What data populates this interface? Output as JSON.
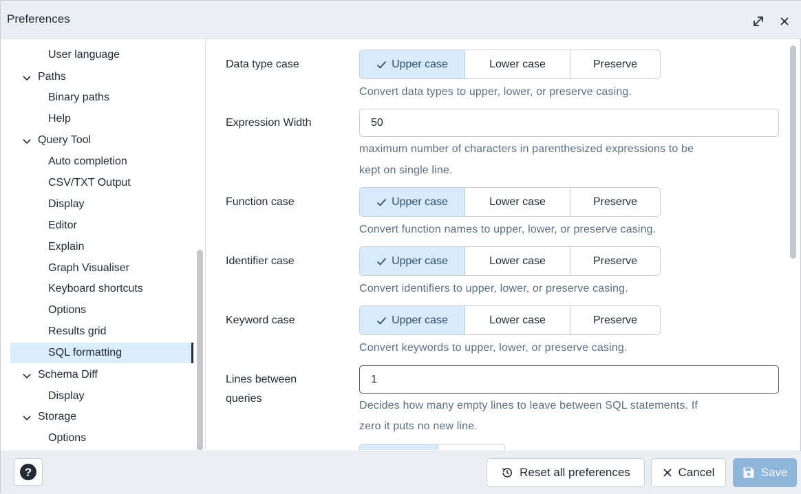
{
  "window": {
    "title": "Preferences",
    "icons": {
      "expand": "expand-icon",
      "close": "close-icon"
    }
  },
  "nav": {
    "items": [
      {
        "label": "User language",
        "type": "child"
      },
      {
        "label": "Paths",
        "type": "parent"
      },
      {
        "label": "Binary paths",
        "type": "child"
      },
      {
        "label": "Help",
        "type": "child"
      },
      {
        "label": "Query Tool",
        "type": "parent"
      },
      {
        "label": "Auto completion",
        "type": "child"
      },
      {
        "label": "CSV/TXT Output",
        "type": "child"
      },
      {
        "label": "Display",
        "type": "child"
      },
      {
        "label": "Editor",
        "type": "child"
      },
      {
        "label": "Explain",
        "type": "child"
      },
      {
        "label": "Graph Visualiser",
        "type": "child"
      },
      {
        "label": "Keyboard shortcuts",
        "type": "child"
      },
      {
        "label": "Options",
        "type": "child"
      },
      {
        "label": "Results grid",
        "type": "child"
      },
      {
        "label": "SQL formatting",
        "type": "child",
        "active": true
      },
      {
        "label": "Schema Diff",
        "type": "parent"
      },
      {
        "label": "Display",
        "type": "child"
      },
      {
        "label": "Storage",
        "type": "parent"
      },
      {
        "label": "Options",
        "type": "child"
      }
    ]
  },
  "settings": {
    "data_type_case": {
      "label": "Data type case",
      "options": [
        "Upper case",
        "Lower case",
        "Preserve"
      ],
      "selected": "Upper case",
      "help": "Convert data types to upper, lower, or preserve casing."
    },
    "expression_width": {
      "label": "Expression Width",
      "value": "50",
      "help_line1": "maximum number of characters in parenthesized expressions to be",
      "help_line2": "kept on single line."
    },
    "function_case": {
      "label": "Function case",
      "options": [
        "Upper case",
        "Lower case",
        "Preserve"
      ],
      "selected": "Upper case",
      "help": "Convert function names to upper, lower, or preserve casing."
    },
    "identifier_case": {
      "label": "Identifier case",
      "options": [
        "Upper case",
        "Lower case",
        "Preserve"
      ],
      "selected": "Upper case",
      "help": "Convert identifiers to upper, lower, or preserve casing."
    },
    "keyword_case": {
      "label": "Keyword case",
      "options": [
        "Upper case",
        "Lower case",
        "Preserve"
      ],
      "selected": "Upper case",
      "help": "Convert keywords to upper, lower, or preserve casing."
    },
    "lines_between_queries": {
      "label_line1": "Lines between",
      "label_line2": "queries",
      "value": "1",
      "help_line1": "Decides how many empty lines to leave between SQL statements. If",
      "help_line2": "zero it puts no new line."
    }
  },
  "footer": {
    "help_icon": "question-circle-icon",
    "reset_label": "Reset all preferences",
    "cancel_label": "Cancel",
    "save_label": "Save",
    "save_enabled": false
  },
  "colors": {
    "selected_segment": "#d8ebfa",
    "active_nav": "#dbecfa",
    "help_text": "#5c6e80",
    "save_disabled": "#8fb5d9"
  }
}
